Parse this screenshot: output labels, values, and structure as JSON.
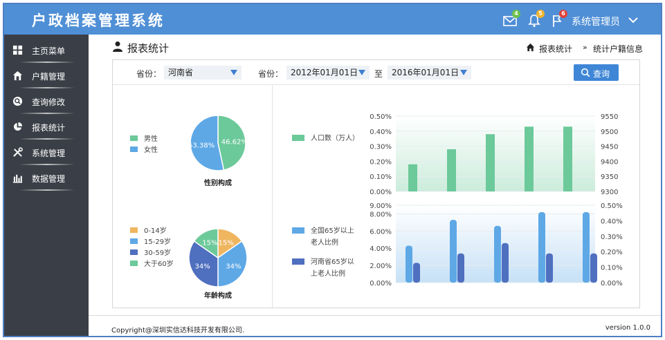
{
  "app": {
    "title": "户政档案管理系统",
    "user": "系统管理员",
    "badges": {
      "mail": "4",
      "bell": "5",
      "flag": "6"
    }
  },
  "icons": {
    "mail": "envelope-icon",
    "bell": "bell-icon",
    "flag": "flag-icon",
    "user_menu": "chevron-down-icon",
    "page": "user-icon",
    "home": "home-icon",
    "search": "search-icon"
  },
  "colors": {
    "header": "#4f8fd6",
    "sidebar": "#3a3f47",
    "badge_mail": "#6cc24a",
    "badge_bell": "#f0b32e",
    "badge_flag": "#e0433a",
    "green": "#6cc99a",
    "blue": "#5ea8e6",
    "dark_blue": "#4f6fbf",
    "orange": "#efb55f"
  },
  "sidebar": {
    "items": [
      {
        "label": "主页菜单",
        "icon": "grid-icon"
      },
      {
        "label": "户籍管理",
        "icon": "house-icon"
      },
      {
        "label": "查询修改",
        "icon": "search-circle-icon"
      },
      {
        "label": "报表统计",
        "icon": "pie-chart-icon"
      },
      {
        "label": "系统管理",
        "icon": "tools-icon"
      },
      {
        "label": "数据管理",
        "icon": "bar-chart-icon"
      }
    ]
  },
  "page": {
    "title": "报表统计",
    "breadcrumb": [
      "报表统计",
      "统计户籍信息"
    ],
    "breadcrumb_sep": "»"
  },
  "filters": {
    "province_label_1": "省份：",
    "province_value_1": "河南省",
    "province_label_2": "省份：",
    "date_from": "2012年01月01日",
    "to_label": "至",
    "date_to": "2016年01月01日",
    "query_label": "查询"
  },
  "chart_data": [
    {
      "type": "pie",
      "title": "性别构成",
      "labels": [
        "男性",
        "女性"
      ],
      "values": [
        46.62,
        53.38
      ],
      "value_labels": [
        "46.62%",
        "53.38%"
      ],
      "colors": [
        "#6cc99a",
        "#5ea8e6"
      ],
      "legend": "left"
    },
    {
      "type": "pie",
      "title": "年龄构成",
      "labels": [
        "0-14岁",
        "15-29岁",
        "30-59岁",
        "大于60岁"
      ],
      "values": [
        15,
        34,
        34,
        15
      ],
      "value_labels": [
        "15%",
        "34%",
        "34%",
        "15%"
      ],
      "colors": [
        "#efb55f",
        "#5ea8e6",
        "#4f6fbf",
        "#6cc99a"
      ],
      "legend": "left"
    },
    {
      "type": "bar",
      "series": [
        {
          "name": "人口数（万人）",
          "values": [
            0.18,
            0.28,
            0.38,
            0.43,
            0.43
          ]
        }
      ],
      "ylim": [
        0,
        0.5
      ],
      "y_ticks": [
        "0.00%",
        "0.10%",
        "0.20%",
        "0.30%",
        "0.40%",
        "0.50%"
      ],
      "y2lim": [
        9300,
        9550
      ],
      "y2_ticks": [
        "9300",
        "9350",
        "9400",
        "9450",
        "9500",
        "9550"
      ],
      "color": "#6cc99a",
      "legend": "left"
    },
    {
      "type": "bar",
      "series": [
        {
          "name": "全国65岁以上老人比例",
          "name_lines": [
            "全国65岁以上",
            "老人比例"
          ],
          "values": [
            4.3,
            7.3,
            6.6,
            8.2,
            8.2
          ]
        },
        {
          "name": "河南省65岁以上老人比例",
          "name_lines": [
            "河南省65岁以",
            "上老人比例"
          ],
          "values": [
            2.3,
            3.4,
            4.6,
            3.4,
            3.4
          ]
        }
      ],
      "ylim": [
        0,
        9
      ],
      "y_ticks": [
        "0.00%",
        "2.00%",
        "4.00%",
        "6.00%",
        "8.00%",
        "9.00%"
      ],
      "y_tick_values": [
        0,
        2,
        4,
        6,
        8,
        9
      ],
      "y2_ticks": [
        "0.00%",
        "0.10%",
        "0.20%",
        "0.30%",
        "0.40%",
        "0.50%"
      ],
      "colors": [
        "#5ea8e6",
        "#4f6fbf"
      ],
      "legend": "left"
    }
  ],
  "footer": {
    "copyright": "Copyright@深圳实信达科技开发有限公司.",
    "version": "version 1.0.0"
  }
}
